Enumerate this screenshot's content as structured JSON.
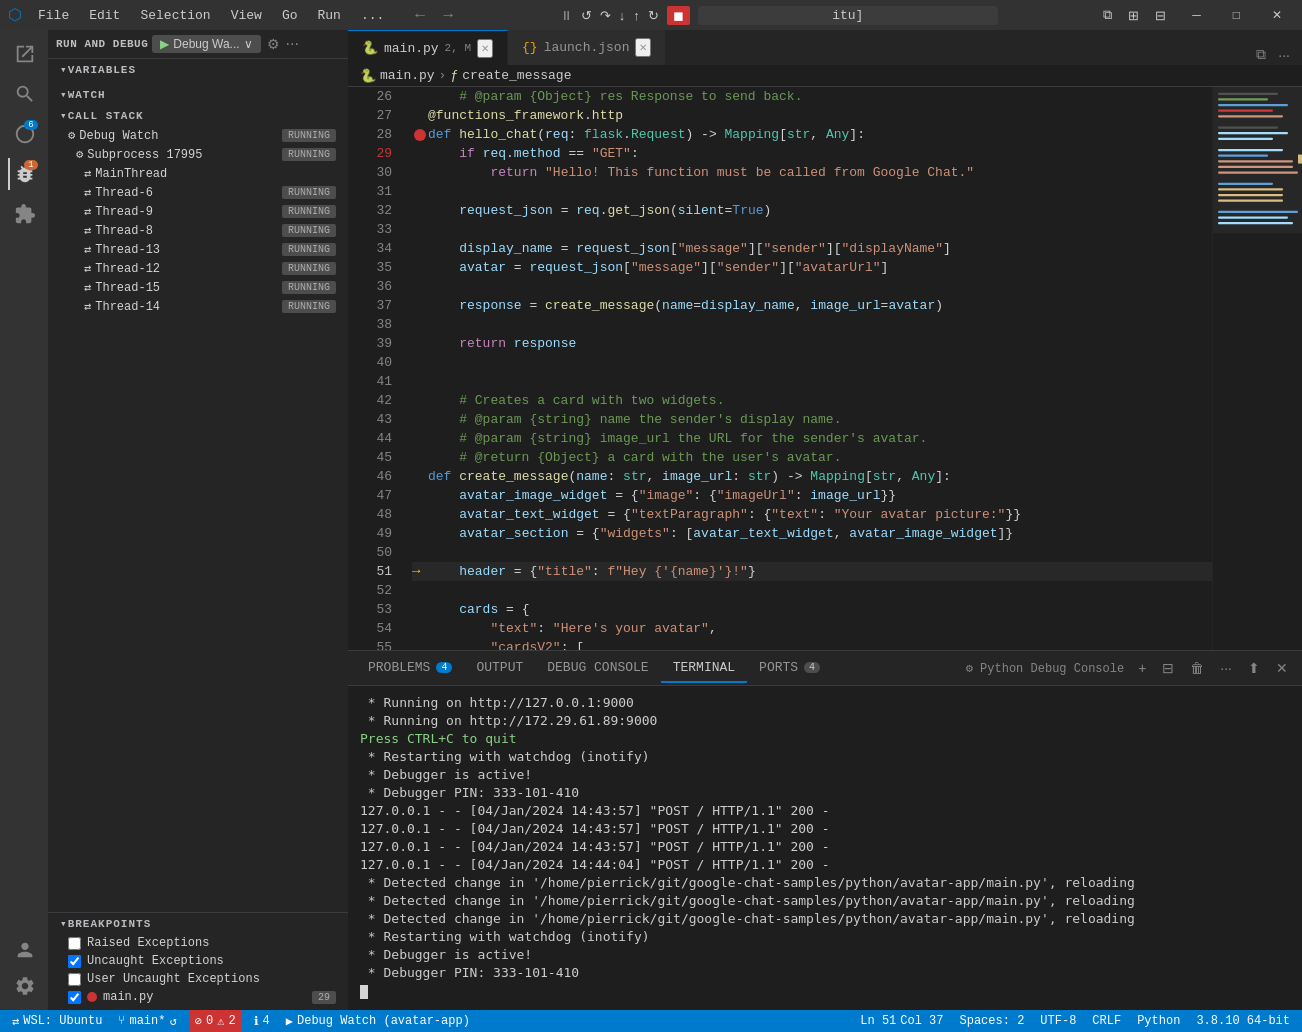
{
  "titlebar": {
    "menu_items": [
      "File",
      "Edit",
      "Selection",
      "View",
      "Go",
      "Run",
      "..."
    ],
    "path": "itu]",
    "icon": "⬡"
  },
  "debug": {
    "label": "RUN AND DEBUG",
    "run_button": "▶",
    "config": "Debug Wa...",
    "gear_title": "Open launch.json",
    "more_title": "More"
  },
  "sidebar": {
    "variables_label": "VARIABLES",
    "watch_label": "WATCH",
    "callstack_label": "CALL STACK",
    "callstack_items": [
      {
        "name": "Debug Watch",
        "status": "RUNNING",
        "indent": 1,
        "type": "process"
      },
      {
        "name": "Subprocess 17995",
        "status": "RUNNING",
        "indent": 2,
        "type": "process"
      },
      {
        "name": "MainThread",
        "status": "",
        "indent": 3,
        "type": "thread"
      },
      {
        "name": "Thread-6",
        "status": "RUNNING",
        "indent": 3,
        "type": "thread"
      },
      {
        "name": "Thread-9",
        "status": "RUNNING",
        "indent": 3,
        "type": "thread"
      },
      {
        "name": "Thread-8",
        "status": "RUNNING",
        "indent": 3,
        "type": "thread"
      },
      {
        "name": "Thread-13",
        "status": "RUNNING",
        "indent": 3,
        "type": "thread"
      },
      {
        "name": "Thread-12",
        "status": "RUNNING",
        "indent": 3,
        "type": "thread"
      },
      {
        "name": "Thread-15",
        "status": "RUNNING",
        "indent": 3,
        "type": "thread"
      },
      {
        "name": "Thread-14",
        "status": "RUNNING",
        "indent": 3,
        "type": "thread"
      }
    ],
    "breakpoints_label": "BREAKPOINTS",
    "breakpoints": [
      {
        "label": "Raised Exceptions",
        "checked": false,
        "has_dot": false
      },
      {
        "label": "Uncaught Exceptions",
        "checked": true,
        "has_dot": false
      },
      {
        "label": "User Uncaught Exceptions",
        "checked": false,
        "has_dot": false
      },
      {
        "label": "main.py",
        "checked": true,
        "has_dot": true,
        "count": "29"
      }
    ]
  },
  "tabs": [
    {
      "label": "main.py",
      "modified": true,
      "marker": "2, M",
      "active": true,
      "icon": "🐍"
    },
    {
      "label": "launch.json",
      "modified": false,
      "active": false,
      "icon": "{}"
    }
  ],
  "breadcrumb": {
    "file": "main.py",
    "symbol": "create_message"
  },
  "code": {
    "lines": [
      {
        "num": 26,
        "text": "    # @param {Object} res Response to send back.",
        "has_bp": false,
        "current": false
      },
      {
        "num": 27,
        "text": "@functions_framework.http",
        "has_bp": false,
        "current": false
      },
      {
        "num": 28,
        "text": "def hello_chat(req: flask.Request) -> Mapping[str, Any]:",
        "has_bp": false,
        "current": false
      },
      {
        "num": 29,
        "text": "    if req.method == \"GET\":",
        "has_bp": true,
        "current": false
      },
      {
        "num": 30,
        "text": "        return \"Hello! This function must be called from Google Chat.\"",
        "has_bp": false,
        "current": false
      },
      {
        "num": 31,
        "text": "",
        "has_bp": false,
        "current": false
      },
      {
        "num": 32,
        "text": "    request_json = req.get_json(silent=True)",
        "has_bp": false,
        "current": false
      },
      {
        "num": 33,
        "text": "",
        "has_bp": false,
        "current": false
      },
      {
        "num": 34,
        "text": "    display_name = request_json[\"message\"][\"sender\"][\"displayName\"]",
        "has_bp": false,
        "current": false
      },
      {
        "num": 35,
        "text": "    avatar = request_json[\"message\"][\"sender\"][\"avatarUrl\"]",
        "has_bp": false,
        "current": false
      },
      {
        "num": 36,
        "text": "",
        "has_bp": false,
        "current": false
      },
      {
        "num": 37,
        "text": "    response = create_message(name=display_name, image_url=avatar)",
        "has_bp": false,
        "current": false
      },
      {
        "num": 38,
        "text": "",
        "has_bp": false,
        "current": false
      },
      {
        "num": 39,
        "text": "    return response",
        "has_bp": false,
        "current": false
      },
      {
        "num": 40,
        "text": "",
        "has_bp": false,
        "current": false
      },
      {
        "num": 41,
        "text": "",
        "has_bp": false,
        "current": false
      },
      {
        "num": 42,
        "text": "    # Creates a card with two widgets.",
        "has_bp": false,
        "current": false
      },
      {
        "num": 43,
        "text": "    # @param {string} name the sender's display name.",
        "has_bp": false,
        "current": false
      },
      {
        "num": 44,
        "text": "    # @param {string} image_url the URL for the sender's avatar.",
        "has_bp": false,
        "current": false
      },
      {
        "num": 45,
        "text": "    # @return {Object} a card with the user's avatar.",
        "has_bp": false,
        "current": false
      },
      {
        "num": 46,
        "text": "def create_message(name: str, image_url: str) -> Mapping[str, Any]:",
        "has_bp": false,
        "current": false
      },
      {
        "num": 47,
        "text": "    avatar_image_widget = {\"image\": {\"imageUrl\": image_url}}",
        "has_bp": false,
        "current": false
      },
      {
        "num": 48,
        "text": "    avatar_text_widget = {\"textParagraph\": {\"text\": \"Your avatar picture:\"}}",
        "has_bp": false,
        "current": false
      },
      {
        "num": 49,
        "text": "    avatar_section = {\"widgets\": [avatar_text_widget, avatar_image_widget]}",
        "has_bp": false,
        "current": false
      },
      {
        "num": 50,
        "text": "",
        "has_bp": false,
        "current": false
      },
      {
        "num": 51,
        "text": "    header = {\"title\": f\"Hey {name}!\"}",
        "has_bp": false,
        "current": true
      },
      {
        "num": 52,
        "text": "",
        "has_bp": false,
        "current": false
      },
      {
        "num": 53,
        "text": "    cards = {",
        "has_bp": false,
        "current": false
      },
      {
        "num": 54,
        "text": "        \"text\": \"Here's your avatar\",",
        "has_bp": false,
        "current": false
      },
      {
        "num": 55,
        "text": "        \"cardsV2\": [",
        "has_bp": false,
        "current": false
      }
    ]
  },
  "panel": {
    "tabs": [
      {
        "label": "PROBLEMS",
        "badge": "4",
        "active": false
      },
      {
        "label": "OUTPUT",
        "badge": "",
        "active": false
      },
      {
        "label": "DEBUG CONSOLE",
        "badge": "",
        "active": false
      },
      {
        "label": "TERMINAL",
        "badge": "",
        "active": true
      },
      {
        "label": "PORTS",
        "badge": "4",
        "active": false
      }
    ],
    "terminal_label": "Python Debug Console",
    "terminal_lines": [
      " * Running on http://127.0.0.1:9000",
      " * Running on http://172.29.61.89:9000",
      "Press CTRL+C to quit",
      " * Restarting with watchdog (inotify)",
      " * Debugger is active!",
      " * Debugger PIN: 333-101-410",
      "127.0.0.1 - - [04/Jan/2024 14:43:57] \"POST / HTTP/1.1\" 200 -",
      "127.0.0.1 - - [04/Jan/2024 14:43:57] \"POST / HTTP/1.1\" 200 -",
      "127.0.0.1 - - [04/Jan/2024 14:43:57] \"POST / HTTP/1.1\" 200 -",
      "127.0.0.1 - - [04/Jan/2024 14:44:04] \"POST / HTTP/1.1\" 200 -",
      " * Detected change in '/home/pierrick/git/google-chat-samples/python/avatar-app/main.py', reloading",
      " * Detected change in '/home/pierrick/git/google-chat-samples/python/avatar-app/main.py', reloading",
      " * Detected change in '/home/pierrick/git/google-chat-samples/python/avatar-app/main.py', reloading",
      " * Restarting with watchdog (inotify)",
      " * Debugger is active!",
      " * Debugger PIN: 333-101-410"
    ]
  },
  "statusbar": {
    "wsl": "WSL: Ubuntu",
    "git_branch": "main*",
    "errors": "0",
    "warnings": "2",
    "info": "4",
    "ln": "Ln 51",
    "col": "Col 37",
    "spaces": "Spaces: 2",
    "encoding": "UTF-8",
    "eol": "CRLF",
    "language": "Python",
    "debug": "3.8.10 64-bit",
    "debug_label": "Debug Watch (avatar-app)"
  }
}
